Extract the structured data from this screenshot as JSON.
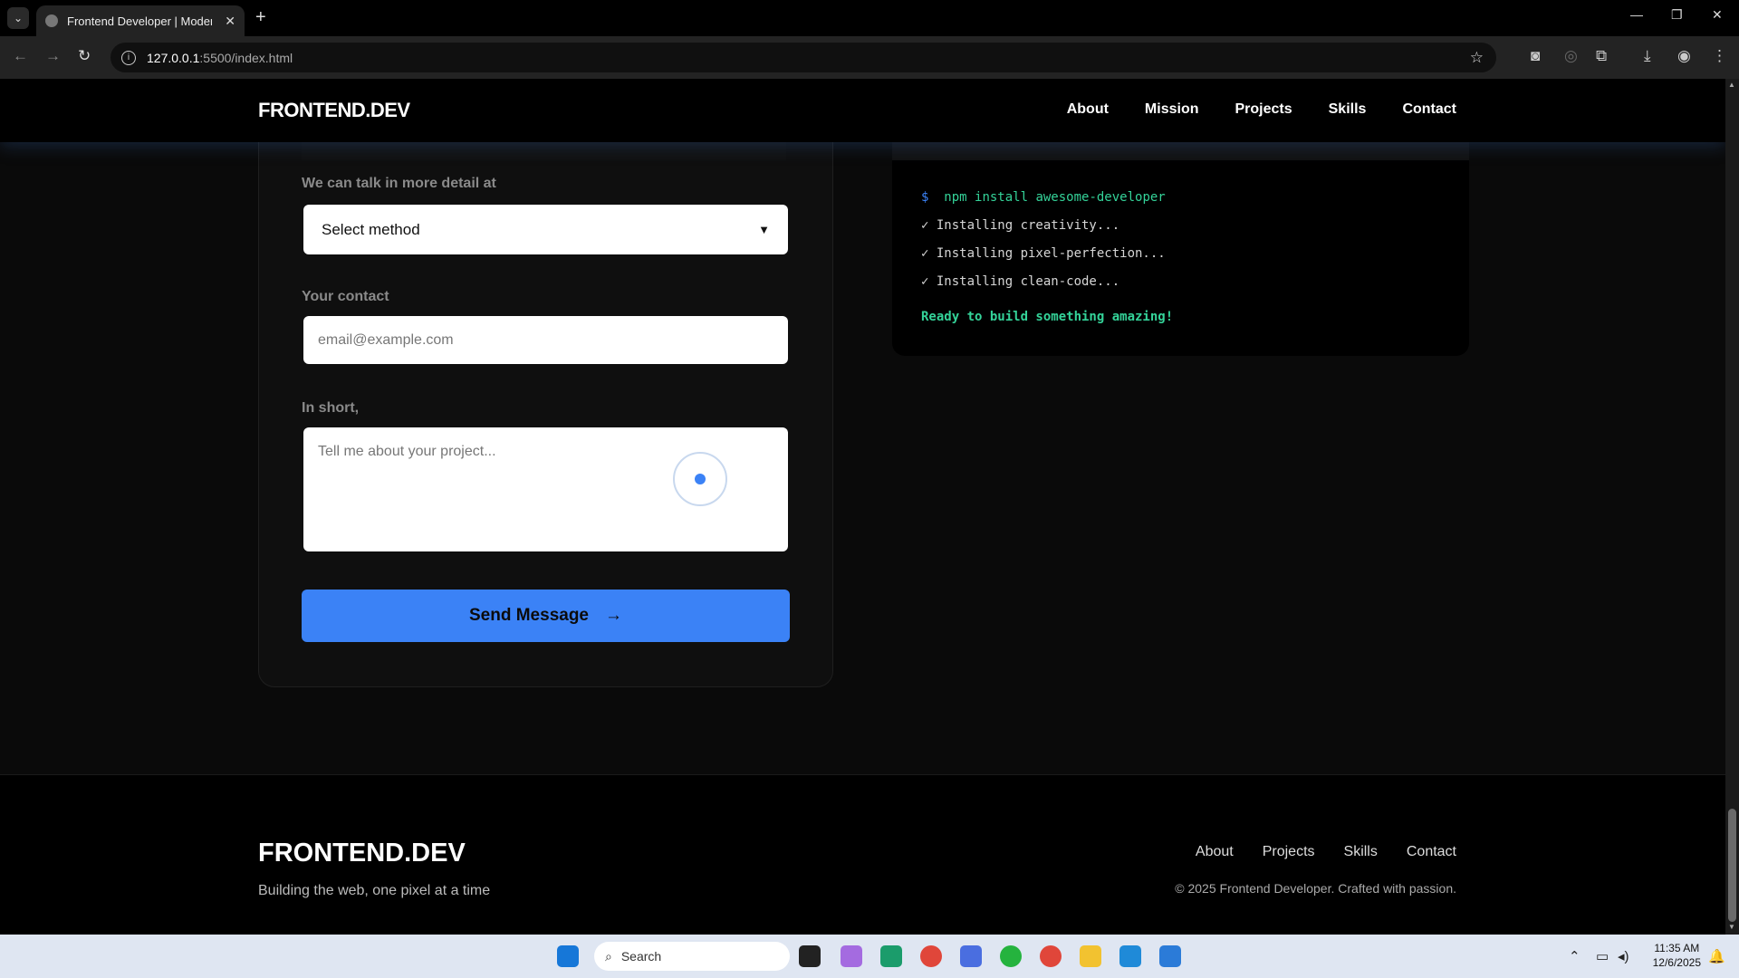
{
  "browser": {
    "tab_title": "Frontend Developer | Modern W",
    "url_host": "127.0.0.1",
    "url_path": ":5500/index.html"
  },
  "site": {
    "logo": "FRONTEND.DEV",
    "nav": [
      "About",
      "Mission",
      "Projects",
      "Skills",
      "Contact"
    ]
  },
  "form": {
    "method_label": "We can talk in more detail at",
    "method_value": "Select method",
    "contact_label": "Your contact",
    "contact_placeholder": "email@example.com",
    "message_label": "In short,",
    "message_placeholder": "Tell me about your project...",
    "send_label": "Send Message",
    "send_arrow": "→"
  },
  "terminal": {
    "prompt": "$",
    "command": "npm install awesome-developer",
    "lines": [
      "✓ Installing creativity...",
      "✓ Installing pixel-perfection...",
      "✓ Installing clean-code..."
    ],
    "success": "Ready to build something amazing!",
    "dot_colors": [
      "#ef4444",
      "#f59e0b",
      "#10b981"
    ]
  },
  "footer": {
    "logo": "FRONTEND.DEV",
    "tagline": "Building the web, one pixel at a time",
    "links": [
      "About",
      "Projects",
      "Skills",
      "Contact"
    ],
    "copyright": "© 2025 Frontend Developer. Crafted with passion."
  },
  "taskbar": {
    "search_label": "Search",
    "time": "11:35 AM",
    "date": "12/6/2025"
  },
  "colors": {
    "accent": "#3b82f6",
    "terminal_green": "#34d399"
  }
}
